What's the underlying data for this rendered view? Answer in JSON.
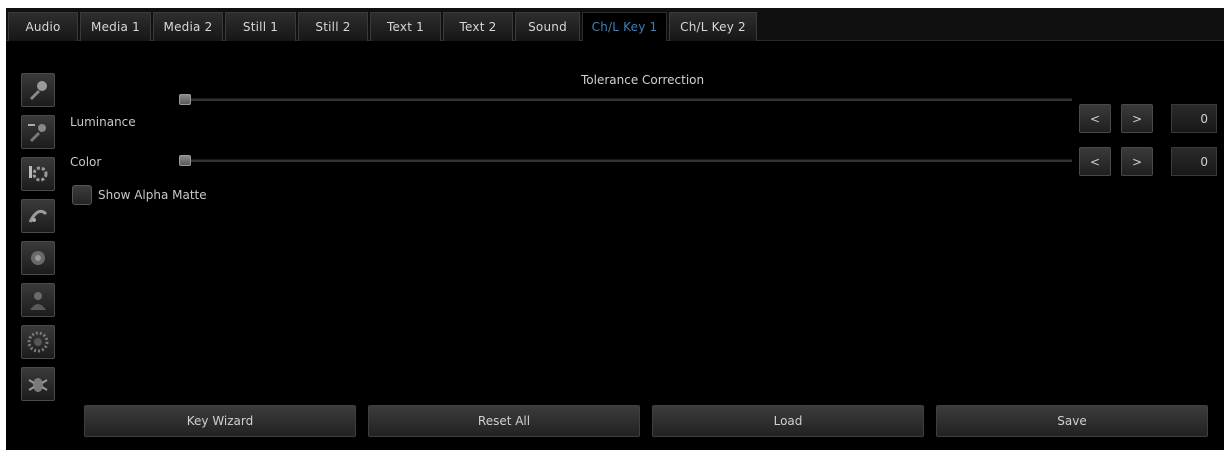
{
  "tabs": [
    {
      "label": "Audio",
      "active": false
    },
    {
      "label": "Media 1",
      "active": false
    },
    {
      "label": "Media 2",
      "active": false
    },
    {
      "label": "Still 1",
      "active": false
    },
    {
      "label": "Still 2",
      "active": false
    },
    {
      "label": "Text 1",
      "active": false
    },
    {
      "label": "Text 2",
      "active": false
    },
    {
      "label": "Sound",
      "active": false
    },
    {
      "label": "Ch/L Key 1",
      "active": true
    },
    {
      "label": "Ch/L Key 2",
      "active": false
    }
  ],
  "sidebar_icons": [
    "eyedropper-icon",
    "eyedropper-minus-icon",
    "gear-icon",
    "spill-suppress-icon",
    "camera-icon",
    "person-silhouette-icon",
    "blur-dial-icon",
    "wizard-bug-icon"
  ],
  "section_title": "Tolerance Correction",
  "luminance": {
    "label": "Luminance",
    "value": "0",
    "dec": "<",
    "inc": ">",
    "level": 0
  },
  "color": {
    "label": "Color",
    "value": "0",
    "dec": "<",
    "inc": ">",
    "level": 0
  },
  "alpha_matte": {
    "label": "Show Alpha Matte",
    "checked": false
  },
  "actions": {
    "key_wizard": "Key Wizard",
    "reset_all": "Reset All",
    "load": "Load",
    "save": "Save"
  },
  "colors": {
    "background": "#000000",
    "active_tab_text": "#3f7fb5",
    "text": "#c8c8c8"
  }
}
